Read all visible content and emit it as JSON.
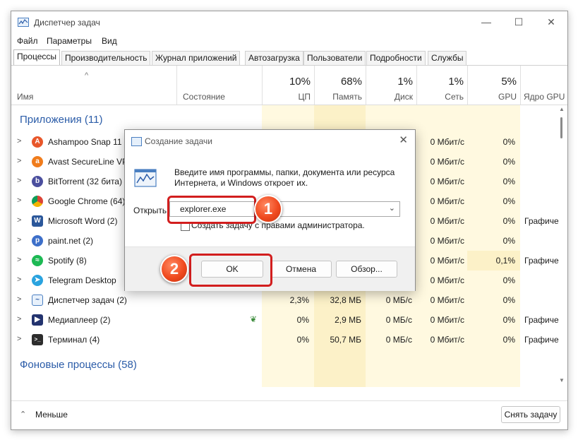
{
  "window": {
    "title": "Диспетчер задач"
  },
  "menu": [
    "Файл",
    "Параметры",
    "Вид"
  ],
  "tabs": [
    "Процессы",
    "Производительность",
    "Журнал приложений",
    "Автозагрузка",
    "Пользователи",
    "Подробности",
    "Службы"
  ],
  "header": {
    "name": "Имя",
    "status": "Состояние",
    "cpu": {
      "pct": "10%",
      "label": "ЦП"
    },
    "mem": {
      "pct": "68%",
      "label": "Память"
    },
    "disk": {
      "pct": "1%",
      "label": "Диск"
    },
    "net": {
      "pct": "1%",
      "label": "Сеть"
    },
    "gpu": {
      "pct": "5%",
      "label": "GPU"
    },
    "gpu_engine": "Ядро GPU"
  },
  "groups": {
    "apps": "Приложения (11)",
    "background": "Фоновые процессы (58)"
  },
  "rows": [
    {
      "name": "Ashampoo Snap 11 (2)",
      "net": "0 Мбит/с",
      "gpu": "0%",
      "engine": ""
    },
    {
      "name": "Avast SecureLine VPN",
      "net": "0 Мбит/с",
      "gpu": "0%",
      "engine": ""
    },
    {
      "name": "BitTorrent (32 бита) (2)",
      "net": "0 Мбит/с",
      "gpu": "0%",
      "engine": ""
    },
    {
      "name": "Google Chrome (64)",
      "net": "0 Мбит/с",
      "gpu": "0%",
      "engine": ""
    },
    {
      "name": "Microsoft Word (2)",
      "net": "0 Мбит/с",
      "gpu": "0%",
      "engine": "Графиче"
    },
    {
      "name": "paint.net (2)",
      "net": "0 Мбит/с",
      "gpu": "0%",
      "engine": ""
    },
    {
      "name": "Spotify (8)",
      "net": "0 Мбит/с",
      "gpu": "0,1%",
      "engine": "Графиче"
    },
    {
      "name": "Telegram Desktop",
      "net": "0 Мбит/с",
      "gpu": "0%",
      "engine": ""
    },
    {
      "name": "Диспетчер задач (2)",
      "cpu": "2,3%",
      "mem": "32,8 МБ",
      "disk": "0 МБ/с",
      "net": "0 Мбит/с",
      "gpu": "0%",
      "engine": ""
    },
    {
      "name": "Медиаплеер (2)",
      "cpu": "0%",
      "mem": "2,9 МБ",
      "disk": "0 МБ/с",
      "net": "0 Мбит/с",
      "gpu": "0%",
      "engine": "Графиче"
    },
    {
      "name": "Терминал (4)",
      "cpu": "0%",
      "mem": "50,7 МБ",
      "disk": "0 МБ/с",
      "net": "0 Мбит/с",
      "gpu": "0%",
      "engine": "Графиче"
    }
  ],
  "footer": {
    "less": "Меньше",
    "end_task": "Снять задачу"
  },
  "dialog": {
    "title": "Создание задачи",
    "message": "Введите имя программы, папки, документа или ресурса Интернета, и Windows откроет их.",
    "open_label": "Открыть:",
    "input_value": "explorer.exe",
    "admin_checkbox": "Создать задачу с правами администратора.",
    "ok": "OK",
    "cancel": "Отмена",
    "browse": "Обзор..."
  },
  "badges": [
    "1",
    "2"
  ],
  "colors": {
    "accent": "#2b5ca8",
    "highlight": "#d21e1e",
    "badge": "#f04a1f",
    "heat_light": "#fff9e0",
    "heat_mid": "#fcf1c8"
  }
}
